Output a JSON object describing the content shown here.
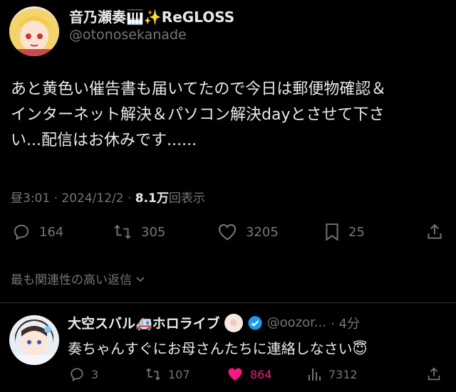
{
  "tweet": {
    "display_name": "音乃瀬奏🎹✨ReGLOSS",
    "handle": "@otonosekanade",
    "text_lines": [
      "あと黄色い催告書も届いてたので今日は郵便物確認＆",
      "インターネット解決＆パソコン解決dayとさせて下さ",
      "い...配信はお休みです......"
    ],
    "time": "昼3:01 · 2024/12/2 · ",
    "views_count": "8.1万",
    "views_label": "回表示",
    "actions": {
      "replies": "164",
      "reposts": "305",
      "likes": "3205",
      "bookmarks": "25"
    }
  },
  "sort": {
    "label": "最も関連性の高い返信"
  },
  "reply": {
    "display_name": "大空スバル🚑ホロライブ",
    "handle": "@oozor...",
    "time": "· 4分",
    "text": "奏ちゃんすぐにお母さんたちに連絡しなさい😇",
    "actions": {
      "replies": "3",
      "reposts": "107",
      "likes": "864",
      "views": "7312"
    }
  },
  "colors": {
    "like_active": "#f91880",
    "verified": "#1d9bf0",
    "muted": "#71767b"
  }
}
